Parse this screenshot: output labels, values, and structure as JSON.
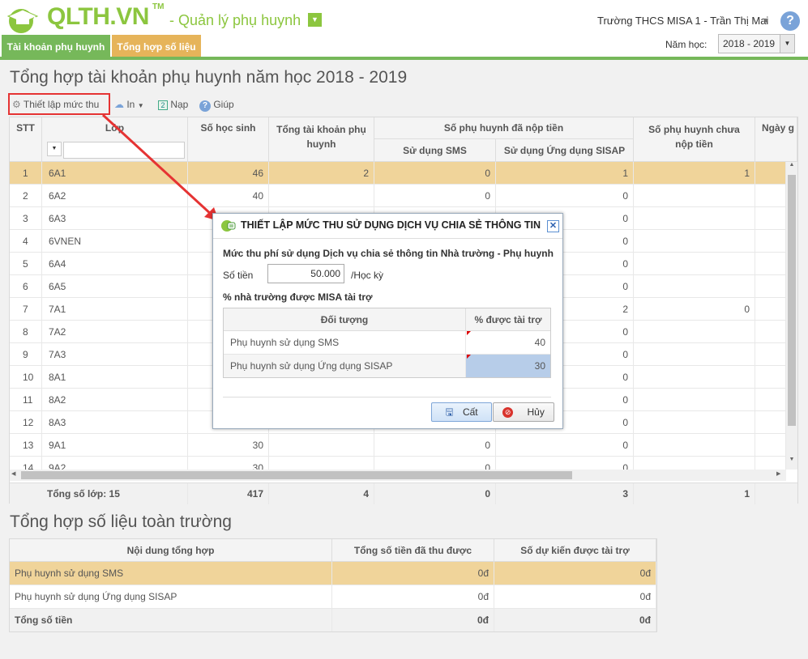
{
  "header": {
    "logo": "QLTH.VN",
    "logo_tm": "TM",
    "app_title": "- Quản lý phụ huynh",
    "user": "Trường THCS MISA 1 - Trần Thị Mai",
    "help": "?",
    "tabs": [
      "Tài khoản phụ huynh",
      "Tổng hợp số liệu"
    ],
    "year_label": "Năm học:",
    "year_value": "2018 - 2019"
  },
  "page_title": "Tổng hợp tài khoản phụ huynh năm học 2018 - 2019",
  "toolbar": {
    "setup": "Thiết lập mức thu",
    "print": "In",
    "reload": "Nạp",
    "help": "Giúp"
  },
  "grid": {
    "headers": {
      "stt": "STT",
      "class": "Lớp",
      "students": "Số học sinh",
      "accounts": "Tổng tài khoản phụ huynh",
      "paid": "Số phụ huynh đã nộp tiền",
      "sms": "Sử dụng SMS",
      "app": "Sử dụng Ứng dụng SISAP",
      "unpaid": "Số phụ huynh chưa nộp tiền",
      "date": "Ngày g"
    },
    "rows": [
      {
        "stt": "1",
        "cls": "6A1",
        "students": "46",
        "accounts": "2",
        "sms": "0",
        "app": "1",
        "unpaid": "1"
      },
      {
        "stt": "2",
        "cls": "6A2",
        "students": "40",
        "accounts": "",
        "sms": "0",
        "app": "0",
        "unpaid": ""
      },
      {
        "stt": "3",
        "cls": "6A3",
        "students": "",
        "accounts": "",
        "sms": "",
        "app": "0",
        "unpaid": ""
      },
      {
        "stt": "4",
        "cls": "6VNEN",
        "students": "",
        "accounts": "",
        "sms": "",
        "app": "0",
        "unpaid": ""
      },
      {
        "stt": "5",
        "cls": "6A4",
        "students": "",
        "accounts": "",
        "sms": "",
        "app": "0",
        "unpaid": ""
      },
      {
        "stt": "6",
        "cls": "6A5",
        "students": "",
        "accounts": "",
        "sms": "",
        "app": "0",
        "unpaid": ""
      },
      {
        "stt": "7",
        "cls": "7A1",
        "students": "",
        "accounts": "",
        "sms": "",
        "app": "2",
        "unpaid": "0"
      },
      {
        "stt": "8",
        "cls": "7A2",
        "students": "",
        "accounts": "",
        "sms": "",
        "app": "0",
        "unpaid": ""
      },
      {
        "stt": "9",
        "cls": "7A3",
        "students": "",
        "accounts": "",
        "sms": "",
        "app": "0",
        "unpaid": ""
      },
      {
        "stt": "10",
        "cls": "8A1",
        "students": "",
        "accounts": "",
        "sms": "",
        "app": "0",
        "unpaid": ""
      },
      {
        "stt": "11",
        "cls": "8A2",
        "students": "",
        "accounts": "",
        "sms": "",
        "app": "0",
        "unpaid": ""
      },
      {
        "stt": "12",
        "cls": "8A3",
        "students": "",
        "accounts": "",
        "sms": "",
        "app": "0",
        "unpaid": ""
      },
      {
        "stt": "13",
        "cls": "9A1",
        "students": "30",
        "accounts": "",
        "sms": "0",
        "app": "0",
        "unpaid": ""
      },
      {
        "stt": "14",
        "cls": "9A2",
        "students": "30",
        "accounts": "",
        "sms": "0",
        "app": "0",
        "unpaid": ""
      }
    ],
    "footer": {
      "label": "Tổng số lớp: 15",
      "students": "417",
      "accounts": "4",
      "sms": "0",
      "app": "3",
      "unpaid": "1"
    }
  },
  "summary": {
    "title": "Tổng hợp số liệu toàn trường",
    "headers": [
      "Nội dung tổng hợp",
      "Tổng số tiền đã thu được",
      "Số dự kiến được tài trợ"
    ],
    "rows": [
      [
        "Phụ huynh sử dụng SMS",
        "0đ",
        "0đ"
      ],
      [
        "Phụ huynh sử dụng Ứng dụng SISAP",
        "0đ",
        "0đ"
      ]
    ],
    "total": [
      "Tổng số tiền",
      "0đ",
      "0đ"
    ]
  },
  "modal": {
    "title": "THIẾT LẬP MỨC THU SỬ DỤNG DỊCH VỤ CHIA SẺ THÔNG TIN",
    "fee_label": "Mức thu phí sử dụng Dịch vụ chia sẻ thông tin Nhà trường - Phụ huynh",
    "amount_label": "Số tiền",
    "amount_value": "50.000",
    "unit": "/Học kỳ",
    "pct_label": "% nhà trường được MISA tài trợ",
    "col_target": "Đối tượng",
    "col_pct": "% được tài trợ",
    "rows": [
      {
        "target": "Phụ huynh sử dụng SMS",
        "pct": "40"
      },
      {
        "target": "Phụ huynh sử dụng Ứng dụng SISAP",
        "pct": "30"
      }
    ],
    "save": "Cất",
    "cancel": "Hủy"
  },
  "colors": {
    "green": "#76b85a",
    "orange": "#e6b45a",
    "highlight": "#f0d49a",
    "annotation": "#e53333"
  }
}
